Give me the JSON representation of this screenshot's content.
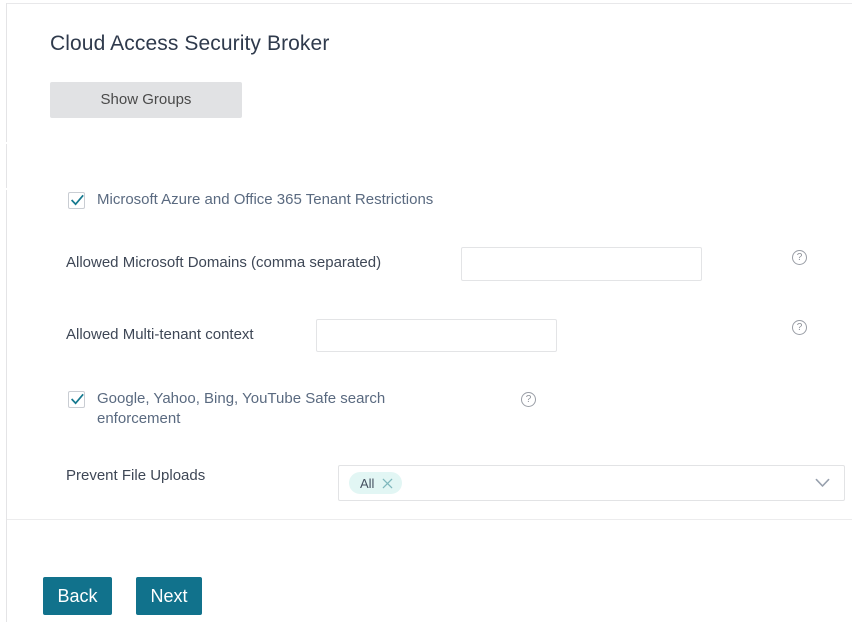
{
  "page": {
    "title": "Cloud Access Security Broker"
  },
  "toolbar": {
    "show_groups_label": "Show Groups"
  },
  "form": {
    "tenant_restrictions": {
      "label": "Microsoft Azure and Office 365 Tenant Restrictions",
      "checked": true
    },
    "allowed_domains": {
      "label": "Allowed Microsoft Domains (comma separated)",
      "value": "",
      "placeholder": "",
      "help_icon": "question-circle-icon",
      "help_label": "?"
    },
    "multitenant_context": {
      "label": "Allowed Multi-tenant context",
      "value": "",
      "placeholder": "",
      "help_icon": "question-circle-icon",
      "help_label": "?"
    },
    "safe_search": {
      "label": "Google, Yahoo, Bing, YouTube Safe search enforcement",
      "checked": true,
      "help_icon": "question-circle-icon",
      "help_label": "?"
    },
    "prevent_file_uploads": {
      "label": "Prevent File Uploads",
      "selected_tags": [
        {
          "label": "All",
          "remove_icon": "close-x-icon"
        }
      ],
      "caret_icon": "chevron-down-icon"
    }
  },
  "footer": {
    "back_label": "Back",
    "next_label": "Next"
  },
  "colors": {
    "accent_button": "#11728c",
    "checkbox_check": "#15798f",
    "tag_background": "#e2f6f4",
    "title_text": "#2f3a4c",
    "checkbox_label_text": "#5a6a80",
    "show_groups_background": "#e1e2e4"
  }
}
